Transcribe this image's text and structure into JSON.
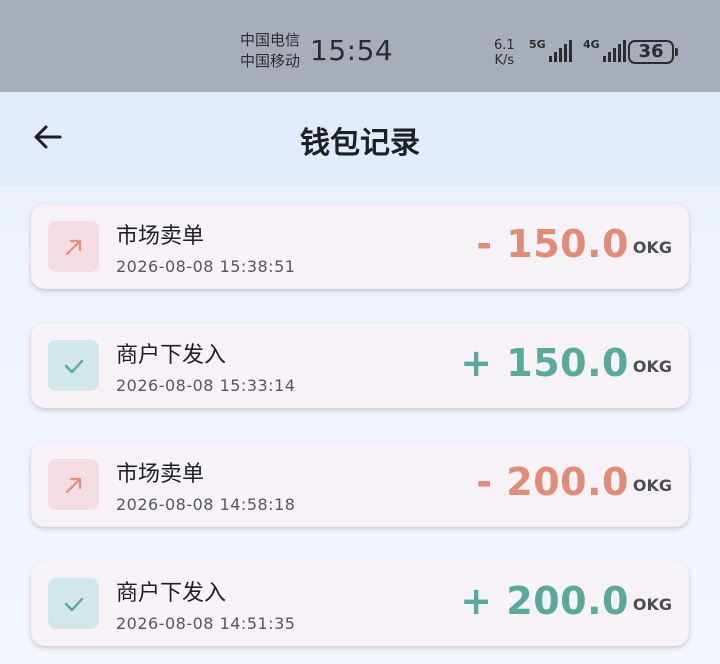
{
  "status_bar": {
    "carrier_1": "中国电信",
    "carrier_2": "中国移动",
    "time": "15:54",
    "net_speed_value": "6.1",
    "net_speed_unit": "K/s",
    "signal_1_label": "5G",
    "signal_2_label": "4G",
    "battery": "36"
  },
  "header": {
    "title": "钱包记录",
    "back_icon": "arrow-left-icon"
  },
  "records": [
    {
      "title": "市场卖单",
      "time": "2026-08-08 15:38:51",
      "amount": "- 150.0",
      "unit": "OKG",
      "type": "out",
      "icon": "arrow-up-right-icon",
      "color": "#df8d78"
    },
    {
      "title": "商户下发入",
      "time": "2026-08-08 15:33:14",
      "amount": "+ 150.0",
      "unit": "OKG",
      "type": "in",
      "icon": "check-icon",
      "color": "#5aa99a"
    },
    {
      "title": "市场卖单",
      "time": "2026-08-08 14:58:18",
      "amount": "- 200.0",
      "unit": "OKG",
      "type": "out",
      "icon": "arrow-up-right-icon",
      "color": "#df8d78"
    },
    {
      "title": "商户下发入",
      "time": "2026-08-08 14:51:35",
      "amount": "+ 200.0",
      "unit": "OKG",
      "type": "in",
      "icon": "check-icon",
      "color": "#5aa99a"
    }
  ]
}
